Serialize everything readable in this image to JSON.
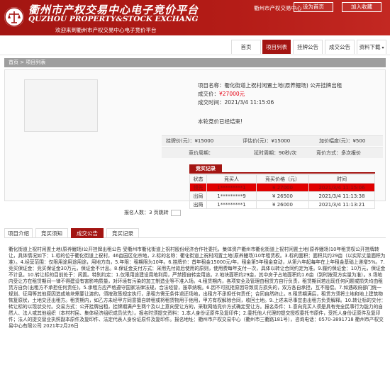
{
  "header": {
    "title": "衢州市产权交易中心电子竞价平台",
    "subtitle": "QUZHOU PROPERTY&STOCK EXCHANG",
    "welcome": "欢迎来到衢州市产权交易中心电子竞价平台",
    "org_name": "衢州市产权交易中心",
    "home_btn": "设为首页",
    "fav_btn": "加入收藏"
  },
  "nav": {
    "items": [
      "首页",
      "项目列表",
      "挂牌公告",
      "成交公告",
      "资料下载"
    ],
    "active_index": 1
  },
  "breadcrumb": "首页 > 项目列表",
  "project": {
    "name_label": "项目名称：",
    "name": "衢化街道上祝村闲置土地(原养鳗场) 公开挂牌出租",
    "price_label": "成交价：",
    "price": "¥27000元",
    "time_label": "成交时间：",
    "time": "2021/3/4 11:15:06",
    "notice": "本轮竞价已经结束!"
  },
  "stats": {
    "row1": [
      {
        "label": "挂牌价(元)：",
        "value": "¥15000"
      },
      {
        "label": "评估价(元)：",
        "value": "¥15000"
      },
      {
        "label": "加价幅度(元)：",
        "value": "¥500"
      }
    ],
    "row2": [
      {
        "label": "竞价周期：",
        "value": ""
      },
      {
        "label": "延时周期：",
        "value": "90秒/次"
      },
      {
        "label": "竞价方式：",
        "value": "多次报价"
      }
    ]
  },
  "records": {
    "tab_label": "竞买记录",
    "headers": [
      "状态",
      "竞买人",
      "竞买价格（元）",
      "时间"
    ],
    "rows": [
      {
        "status": "领先",
        "bidder": "1*********1",
        "price": "¥ 27000",
        "time": "2021/3/4 11:15:06"
      },
      {
        "status": "出局",
        "bidder": "1*********9",
        "price": "¥ 26500",
        "time": "2021/3/4 11:13:38"
      },
      {
        "status": "出局",
        "bidder": "1*********1",
        "price": "¥ 26000",
        "time": "2021/3/4 11:13:21"
      }
    ],
    "pager": "报名人数：3  页跳转"
  },
  "lower_tabs": [
    "项目介绍",
    "竞买须知",
    "成交公告",
    "竞买记录"
  ],
  "lower_active": 2,
  "description": "衢化街道上祝村闲置土地(原养鳗场)公开挂牌出租公告 受衢州市衢化街道上祝村股份经济合作社委托，集体资产衢州市衢化街道上祝村闲置土地(原养鳗场)10年租赁权公开挂牌转让，具体情况如下：1.标的位于衢化街道上祝村，46亩园区化宗地，2.标的名称：衢化街道上祝村闲置土地(原养鳗场)10年租赁权。3.标的面积：面积共约29亩（以实际丈量面积为准）。4.经营范围：仅限用途用途用途，用地方向，5.年限：租期限为10年。6.挂牌价：首年租金15000元/年，租金第5年租金变动，从第六年起每年在上年租金基础上递增5%。7.竞买保证金：竞买保证金30万元，保证金不计息。8.保证金支付方式：采用先付款后使用的原则，使用费每年支付一次，具体以转让合同约定为准。9.履约保证金：10万元，保证金不计息。10.转让标的目前处于：闲置。特别约定：1.仅限用途建设用地利用，严禁擅自转变用途。2.地块面积约29亩，其中房子占地面积约1.6亩（到时按双方实量为准）。3.场地内受让方在租赁期间一律不得建设有害影响质量，对环境有污染的加工制造业等不准入场。4.租赁期内，各项安全及管理由租赁方自行负责，租赁期间若出现任何问题或损失均由租赁方自负(出租方不承担任何责任)。5.承租方应严格遵守国家法律法规，合法经营，按章纳税。6.因不可抗拒原因导致双方损失的，双方各自承担，互不赔偿。7.如遇政府部门统一规划、征用等其他原因造成地块需要让渡的，须按政策规定执行，承租方需无条件退还场地，出租方不承担任何责任；合同自然终止。8.租赁期满后，租赁方须将土地和地上建筑物恢复原状，土地交还出租方。租赁期内，如乙方未经甲方同意擅自转租或将租赁物用于他用，甲方有权解除合同，收回土地。9.上述未尽事宜由出租方负责解释。10.转让标的交付：转让标的以现状交付。交易方式：公开挂牌出租，挂牌期满产生两个及以上意向受让方的，采取网络竞价方式确定受让方。报名条件：1.意向竞买人须是具有完全民事行为能力的自然人、法人或其他组织（本村村民、集体经济组织成员优先）。报名时须提交资料：1.本人身份证原件及复印件；2.委托他人代理的提交授权委托书原件，受托人身份证原件及复印件；法人的提交营业执照副本原件及复印件、法定代表人身份证原件及复印件。报名地址：衢州市产权交易中心（衢州市三衢路181号），咨询电话：0570-3891718 衢州市产权交易中心有限公司 2021年2月26日"
}
